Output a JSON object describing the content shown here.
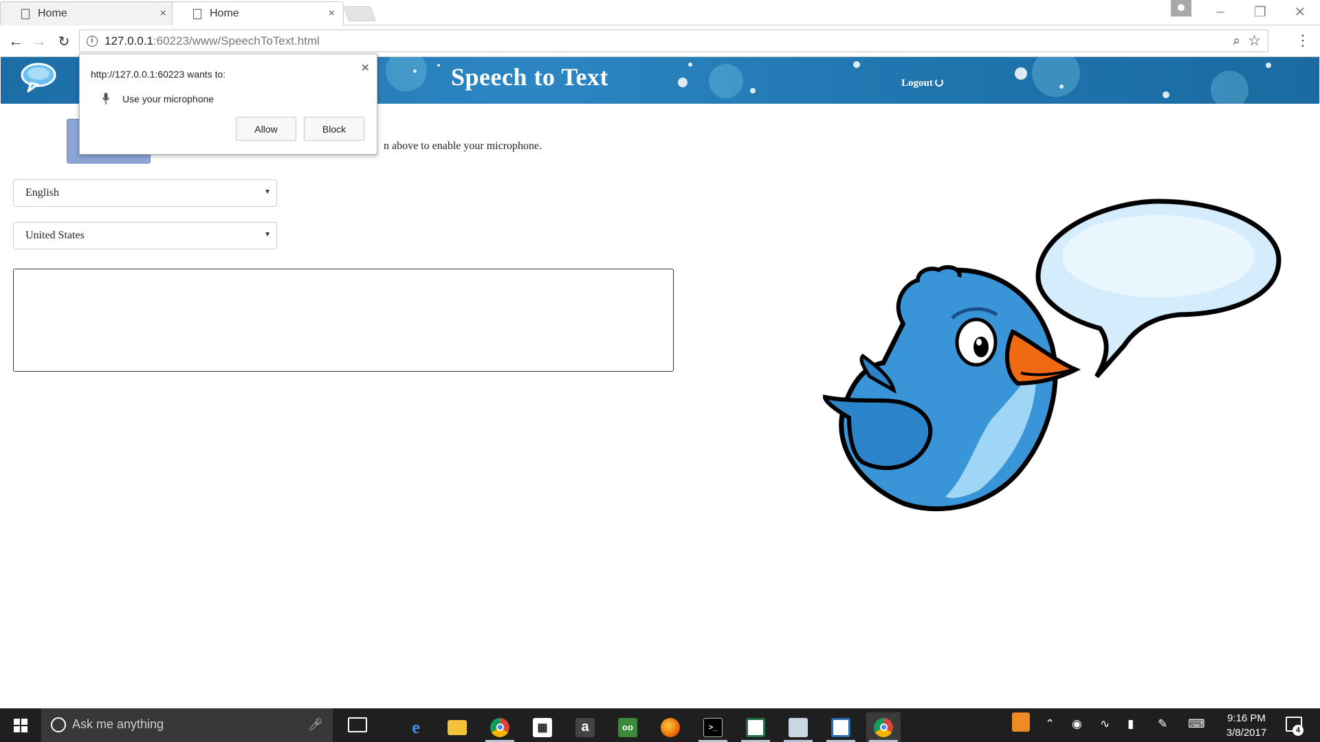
{
  "browser": {
    "tabs": [
      {
        "label": "Home",
        "active": false
      },
      {
        "label": "Home",
        "active": true
      }
    ],
    "tab_close_glyph": "×",
    "address_bar": {
      "host": "127.0.0.1",
      "path": ":60223/www/SpeechToText.html"
    },
    "icons": {
      "back": "back-arrow-icon",
      "forward": "forward-arrow-icon",
      "reload": "reload-icon",
      "info": "info-icon",
      "zoom": "zoom-icon",
      "star": "bookmark-star-icon",
      "menu": "menu-dots-icon"
    }
  },
  "permission_popup": {
    "origin_text": "http://127.0.0.1:60223 wants to:",
    "request_text": "Use your microphone",
    "allow_label": "Allow",
    "block_label": "Block"
  },
  "page": {
    "banner_title": "Speech to Text",
    "logout_label": "Logout",
    "instruction_text": "n above to enable your microphone.",
    "language_select": {
      "value": "English"
    },
    "country_select": {
      "value": "United States"
    },
    "transcript": {
      "value": ""
    },
    "colors": {
      "banner": "#2d86c2",
      "mic_button": "#8da4d6",
      "bird": "#3a95d8",
      "beak": "#f06a14"
    }
  },
  "taskbar": {
    "search_placeholder": "Ask me anything",
    "time": "9:16 PM",
    "date": "3/8/2017",
    "notification_count": "4",
    "apps": [
      "edge-icon",
      "file-explorer-icon",
      "chrome-icon",
      "store-icon",
      "amazon-icon",
      "tripadvisor-icon",
      "firefox-icon",
      "terminal-icon",
      "excel-icon",
      "remote-desktop-icon",
      "app-icon",
      "chrome-active-icon"
    ]
  }
}
